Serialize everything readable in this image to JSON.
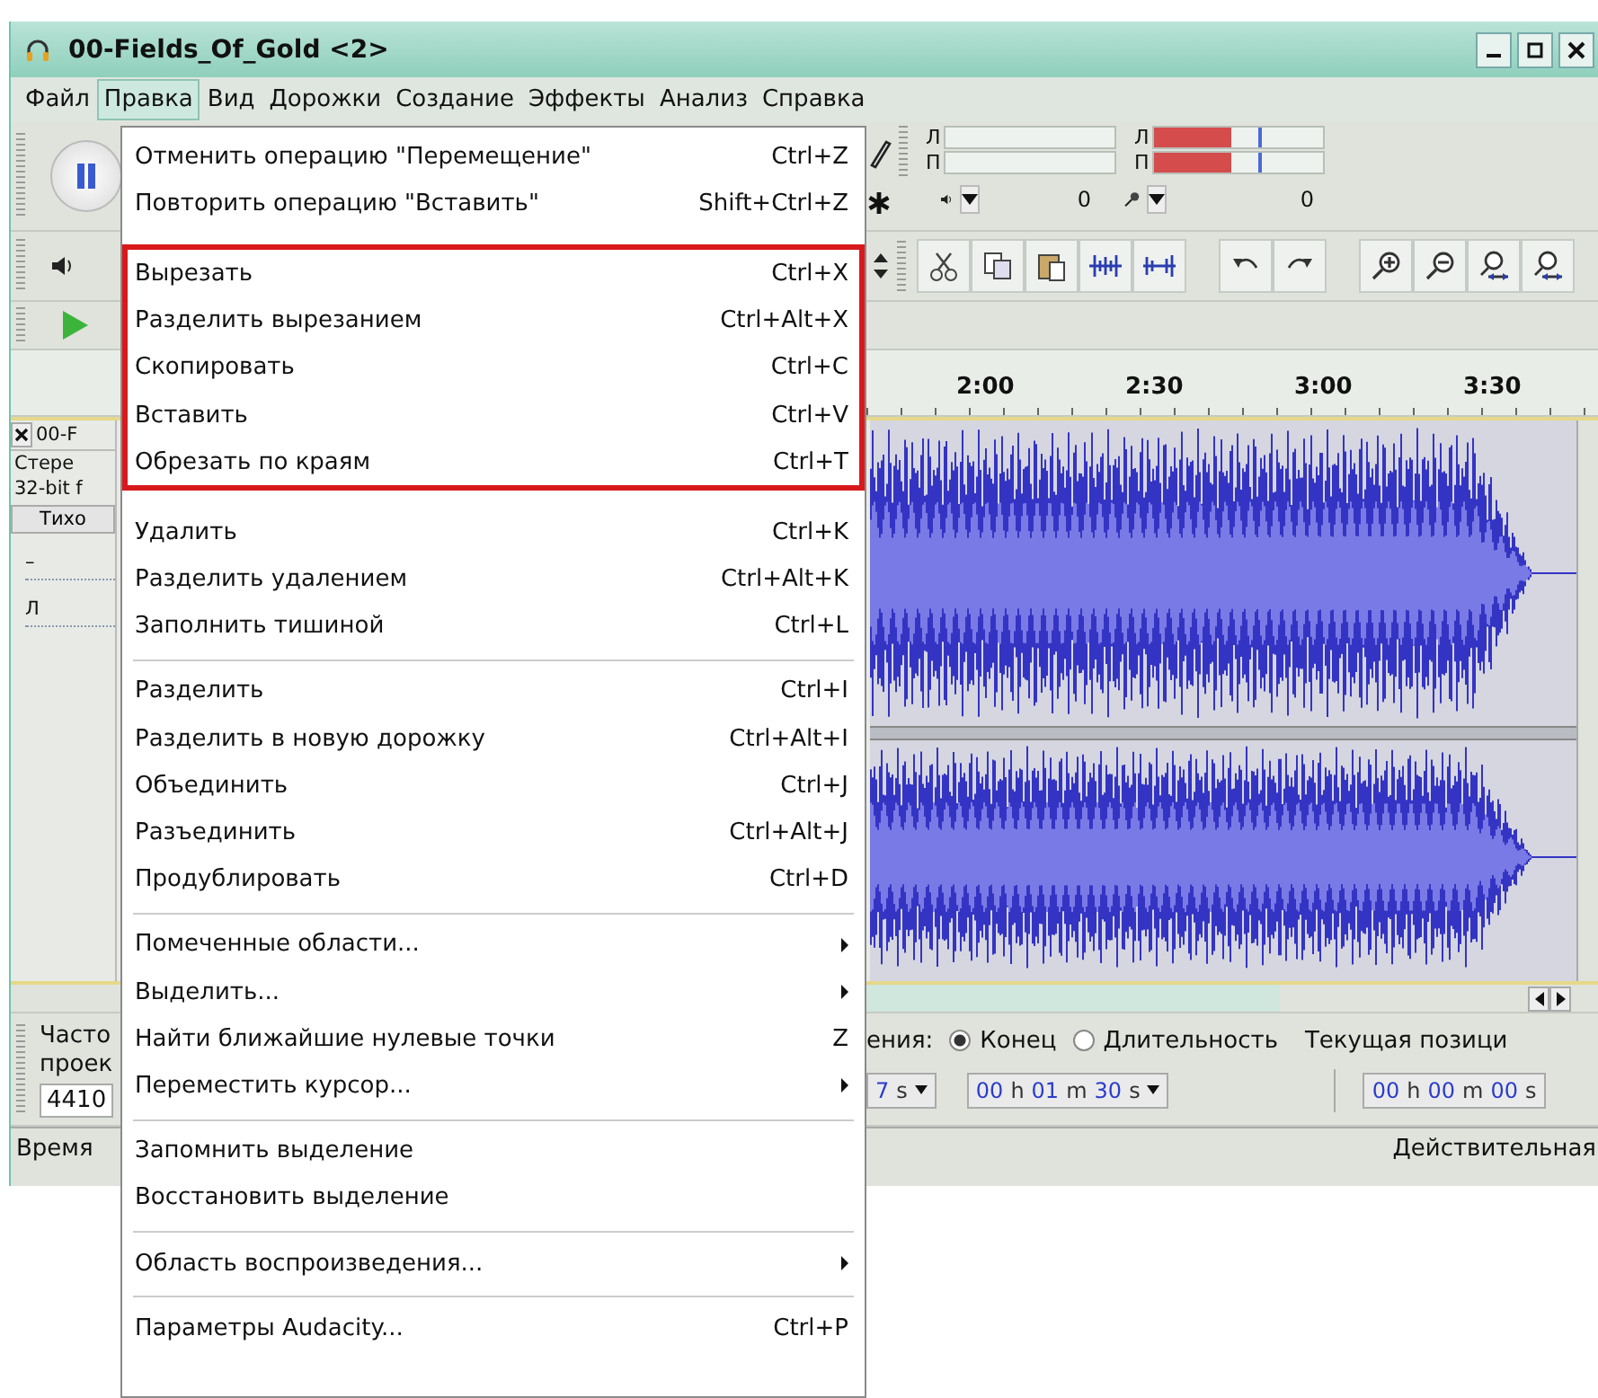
{
  "window": {
    "title": "00-Fields_Of_Gold <2>"
  },
  "menubar": [
    {
      "label": "Файл",
      "selected": false
    },
    {
      "label": "Правка",
      "selected": true
    },
    {
      "label": "Вид",
      "selected": false
    },
    {
      "label": "Дорожки",
      "selected": false
    },
    {
      "label": "Создание",
      "selected": false
    },
    {
      "label": "Эффекты",
      "selected": false
    },
    {
      "label": "Анализ",
      "selected": false
    },
    {
      "label": "Справка",
      "selected": false
    }
  ],
  "edit_menu": {
    "sections": [
      {
        "highlighted": false,
        "items": [
          {
            "label": "Отменить операцию \"Перемещение\"",
            "shortcut": "Ctrl+Z",
            "submenu": false
          },
          {
            "label": "Повторить операцию \"Вставить\"",
            "shortcut": "Shift+Ctrl+Z",
            "submenu": false
          }
        ]
      },
      {
        "highlighted": true,
        "items": [
          {
            "label": "Вырезать",
            "shortcut": "Ctrl+X",
            "submenu": false
          },
          {
            "label": "Разделить вырезанием",
            "shortcut": "Ctrl+Alt+X",
            "submenu": false
          },
          {
            "label": "Скопировать",
            "shortcut": "Ctrl+C",
            "submenu": false
          },
          {
            "label": "Вставить",
            "shortcut": "Ctrl+V",
            "submenu": false
          },
          {
            "label": "Обрезать по краям",
            "shortcut": "Ctrl+T",
            "submenu": false
          }
        ]
      },
      {
        "highlighted": false,
        "items": [
          {
            "label": "Удалить",
            "shortcut": "Ctrl+K",
            "submenu": false
          },
          {
            "label": "Разделить удалением",
            "shortcut": "Ctrl+Alt+K",
            "submenu": false
          },
          {
            "label": "Заполнить тишиной",
            "shortcut": "Ctrl+L",
            "submenu": false
          }
        ]
      },
      {
        "highlighted": false,
        "items": [
          {
            "label": "Разделить",
            "shortcut": "Ctrl+I",
            "submenu": false
          },
          {
            "label": "Разделить в новую дорожку",
            "shortcut": "Ctrl+Alt+I",
            "submenu": false
          },
          {
            "label": "Объединить",
            "shortcut": "Ctrl+J",
            "submenu": false
          },
          {
            "label": "Разъединить",
            "shortcut": "Ctrl+Alt+J",
            "submenu": false
          },
          {
            "label": "Продублировать",
            "shortcut": "Ctrl+D",
            "submenu": false
          }
        ]
      },
      {
        "highlighted": false,
        "items": [
          {
            "label": "Помеченные области...",
            "submenu": true
          },
          {
            "label": "Выделить...",
            "submenu": true
          },
          {
            "label": "Найти ближайшие нулевые точки",
            "shortcut": "Z",
            "submenu": false
          },
          {
            "label": "Переместить курсор...",
            "submenu": true
          }
        ]
      },
      {
        "highlighted": false,
        "items": [
          {
            "label": "Запомнить выделение",
            "submenu": false
          },
          {
            "label": "Восстановить выделение",
            "submenu": false
          }
        ]
      },
      {
        "highlighted": false,
        "items": [
          {
            "label": "Область воспроизведения...",
            "submenu": true
          }
        ]
      },
      {
        "highlighted": false,
        "items": [
          {
            "label": "Параметры Audacity...",
            "shortcut": "Ctrl+P",
            "submenu": false
          }
        ]
      }
    ]
  },
  "meters": {
    "playback": [
      {
        "label": "Л"
      },
      {
        "label": "П"
      }
    ],
    "recording": [
      {
        "label": "Л",
        "level": 0.45
      },
      {
        "label": "П",
        "level": 0.45
      }
    ],
    "playback_volume": "0",
    "recording_volume": "0"
  },
  "ruler": {
    "labels": [
      "2:00",
      "2:30",
      "3:00",
      "3:30"
    ]
  },
  "track": {
    "name": "00-F",
    "info": [
      "Стере",
      "32-bit f"
    ],
    "mute_button": "Тихо",
    "gain_label": "–",
    "pan_label": "Л"
  },
  "selection_bar": {
    "rate_label": [
      "Часто",
      "проек"
    ],
    "rate_value": "4410",
    "end_label": "ения:",
    "options": [
      {
        "label": "Конец",
        "selected": true
      },
      {
        "label": "Длительность",
        "selected": false
      }
    ],
    "position_label": "Текущая позици",
    "fields": [
      "7 s",
      "00 h 01 m 30 s"
    ],
    "position_value": "00 h 00 m 00 s"
  },
  "status_bar": {
    "left": "Время",
    "right": "Действительная"
  }
}
